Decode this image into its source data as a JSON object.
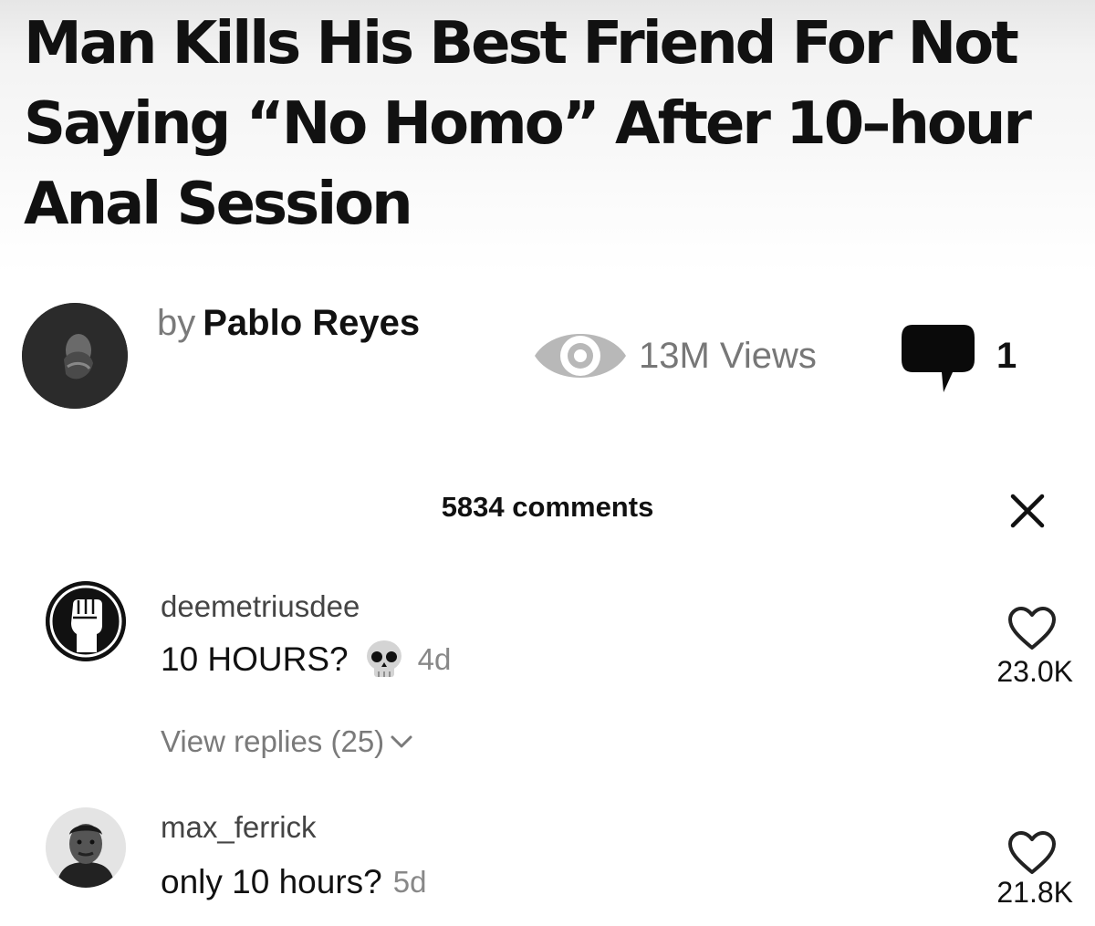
{
  "article": {
    "headline": "Man Kills His Best Friend For Not Saying “No Homo” After 10–hour Anal Session",
    "by_label": "by",
    "author": "Pablo Reyes",
    "views": "13M Views",
    "comment_count": "1"
  },
  "comments_panel": {
    "title": "5834 comments",
    "comments": [
      {
        "username": "deemetriusdee",
        "text": "10 HOURS?",
        "emoji_icon": "skull-icon",
        "age": "4d",
        "likes": "23.0K",
        "replies_label": "View replies (25)"
      },
      {
        "username": "max_ferrick",
        "text": "only 10 hours?",
        "age": "5d",
        "likes": "21.8K"
      }
    ]
  },
  "icons": {
    "views": "eye-icon",
    "comments": "speech-bubble-icon",
    "close": "close-icon",
    "like": "heart-icon",
    "expand": "chevron-down-icon"
  },
  "colors": {
    "text": "#111111",
    "muted": "#7a7a7a",
    "background": "#ffffff"
  }
}
